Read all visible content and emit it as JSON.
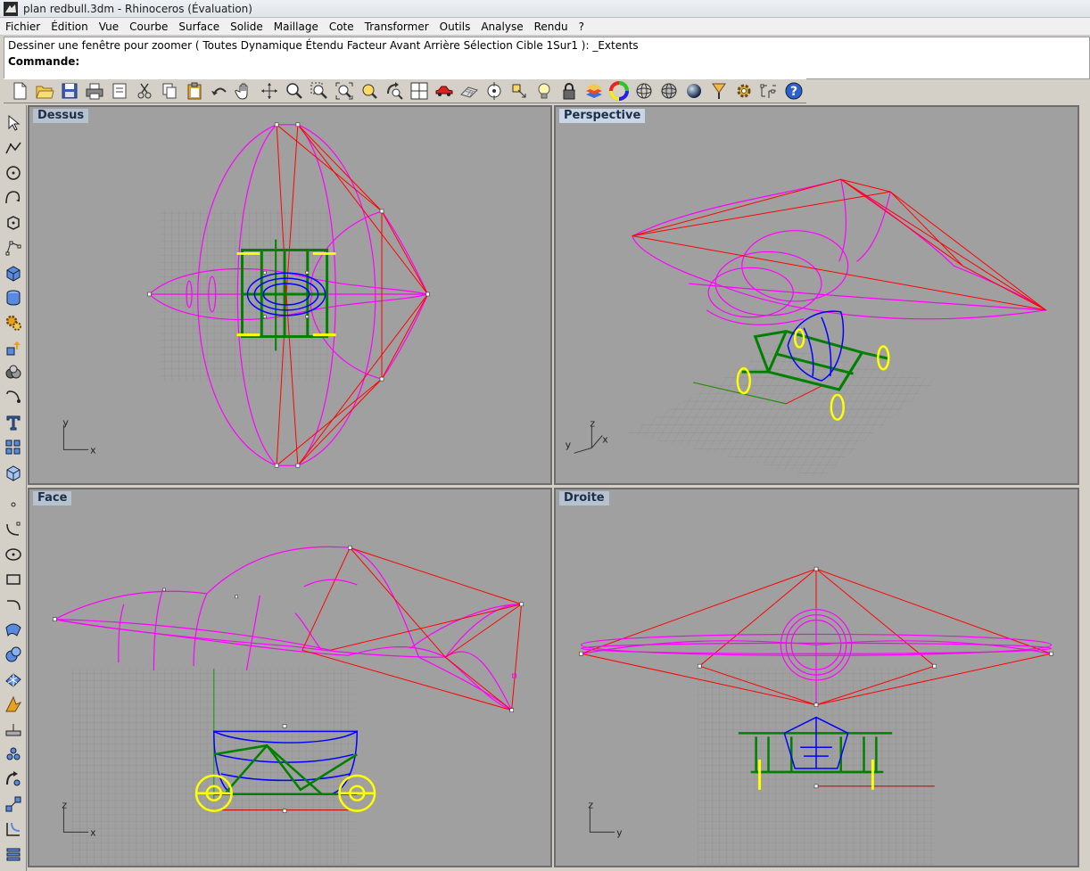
{
  "window": {
    "title": "plan redbull.3dm - Rhinoceros (Évaluation)"
  },
  "menu": [
    "Fichier",
    "Édition",
    "Vue",
    "Courbe",
    "Surface",
    "Solide",
    "Maillage",
    "Cote",
    "Transformer",
    "Outils",
    "Analyse",
    "Rendu",
    "?"
  ],
  "command": {
    "history": "Dessiner une fenêtre pour zoomer ( Toutes  Dynamique  Étendu  Facteur  Avant  Arrière  Sélection  Cible  1Sur1 ): _Extents",
    "prompt": "Commande:",
    "value": ""
  },
  "toolbar_icons": [
    "new-file-icon",
    "open-folder-icon",
    "save-icon",
    "print-icon",
    "properties-icon",
    "cut-icon",
    "copy-icon",
    "paste-icon",
    "undo-icon",
    "pan-hand-icon",
    "rotate-view-icon",
    "zoom-dynamic-icon",
    "zoom-window-icon",
    "zoom-extents-icon",
    "zoom-selected-icon",
    "rotate-view-3d-icon",
    "four-viewports-icon",
    "car-render-icon",
    "plane-grid-icon",
    "snap-target-icon",
    "point-cloud-icon",
    "light-bulb-icon",
    "lock-icon",
    "layers-icon",
    "color-wheel-icon",
    "sphere-wire-icon",
    "sphere-shaded-icon",
    "sphere-render-icon",
    "gear-settings-icon",
    "dimension-icon",
    "help-icon"
  ],
  "left_toolbar_icons": [
    "select-arrow-icon",
    "polyline-icon",
    "circle-icon",
    "curve-icon",
    "polygon-icon",
    "control-points-icon",
    "box-solid-icon",
    "cylinder-icon",
    "transform-gear-icon",
    "extrude-icon",
    "boolean-icon",
    "fillet-icon",
    "text-icon",
    "array-icon",
    "display-mode-icon",
    "point-icon",
    "curve-point-icon",
    "circle-center-icon",
    "rectangle-icon",
    "arc-icon",
    "surface-patch-icon",
    "solid-sphere-icon",
    "mesh-icon",
    "analyze-icon",
    "dimension-left-icon",
    "layers-left-icon",
    "render-left-icon",
    "misc-left-icon",
    "fillet-edge-icon",
    "history-icon",
    "list-icon"
  ],
  "viewports": [
    {
      "name": "Dessus",
      "axes": [
        "y",
        "x"
      ]
    },
    {
      "name": "Perspective",
      "axes": [
        "z",
        "y",
        "x"
      ]
    },
    {
      "name": "Face",
      "axes": [
        "z",
        "x"
      ]
    },
    {
      "name": "Droite",
      "axes": [
        "z",
        "y"
      ]
    }
  ],
  "colors": {
    "hull": "#ff00ff",
    "cage": "#ff0000",
    "frame": "#008000",
    "cockpit": "#0000ff",
    "wheel": "#ffff00",
    "viewport_bg": "#a0a0a0",
    "grid": "#8a8a8a"
  }
}
